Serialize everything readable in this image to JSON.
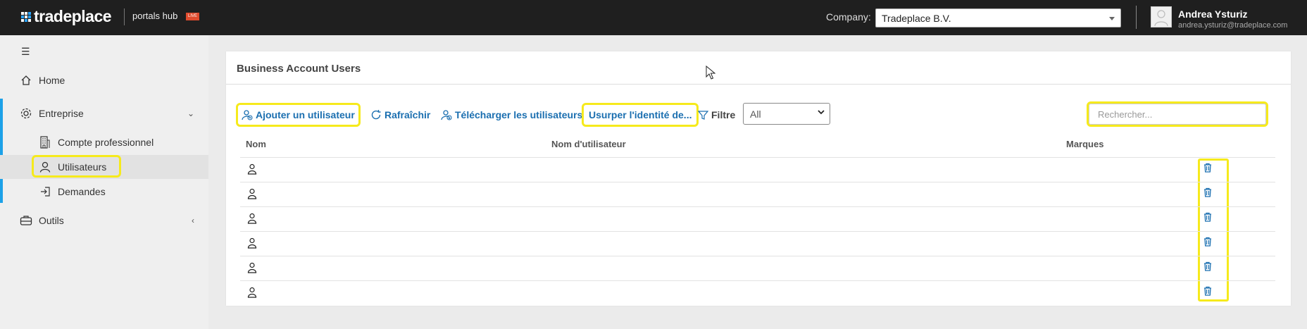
{
  "header": {
    "logo_text": "tradeplace",
    "portals_label": "portals hub",
    "live_badge": "LIVE",
    "company_label": "Company:",
    "company_value": "Tradeplace B.V.",
    "user_name": "Andrea Ysturiz",
    "user_email": "andrea.ysturiz@tradeplace.com"
  },
  "sidebar": {
    "menu_icon": "☰",
    "items": [
      {
        "label": "Home",
        "icon": "home-icon"
      },
      {
        "label": "Entreprise",
        "icon": "settings-cog-icon"
      },
      {
        "label": "Compte professionnel",
        "icon": "building-icon"
      },
      {
        "label": "Utilisateurs",
        "icon": "user-icon"
      },
      {
        "label": "Demandes",
        "icon": "sign-in-icon"
      },
      {
        "label": "Outils",
        "icon": "toolbox-icon"
      }
    ],
    "expanded_arrow": "⌄",
    "collapsed_arrow": "‹"
  },
  "main": {
    "title": "Business Account Users",
    "toolbar": {
      "add_user": "Ajouter un utilisateur",
      "refresh": "Rafraîchir",
      "download_users": "Télécharger les utilisateurs",
      "impersonate": "Usurper l'identité de...",
      "filter_label": "Filtre",
      "filter_value": "All",
      "search_placeholder": "Rechercher..."
    },
    "table": {
      "columns": [
        "Nom",
        "Nom d'utilisateur",
        "Marques"
      ],
      "rows": [
        {
          "name": "",
          "username": "",
          "brands": ""
        },
        {
          "name": "",
          "username": "",
          "brands": ""
        },
        {
          "name": "",
          "username": "",
          "brands": ""
        },
        {
          "name": "",
          "username": "",
          "brands": ""
        },
        {
          "name": "",
          "username": "",
          "brands": ""
        },
        {
          "name": "",
          "username": "",
          "brands": ""
        }
      ]
    }
  },
  "colors": {
    "topbar": "#1f1f1f",
    "accent": "#1ca1e8",
    "link": "#1b6fb0",
    "highlight": "#f6ea1c",
    "live": "#e04b2d"
  }
}
